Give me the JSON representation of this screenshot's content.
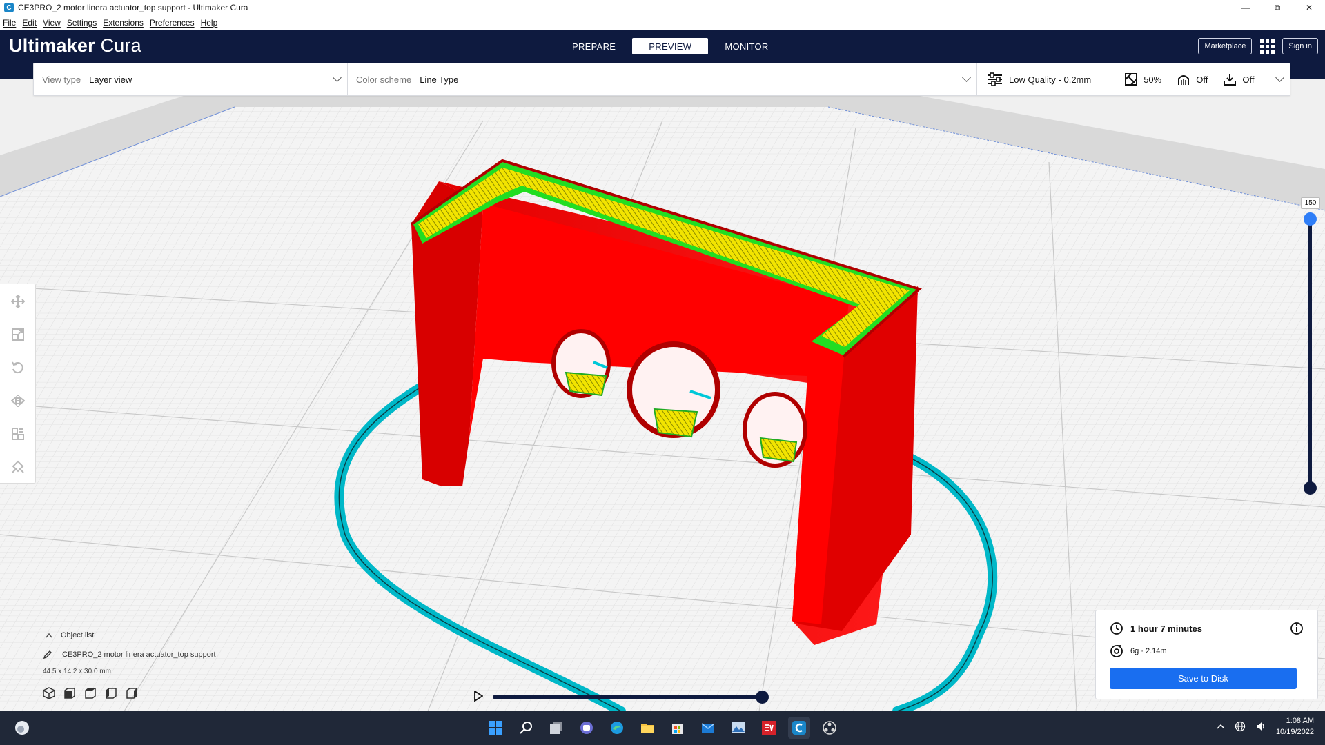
{
  "window": {
    "title": "CE3PRO_2 motor linera actuator_top support - Ultimaker Cura",
    "app_icon_letter": "C",
    "minimize": "—",
    "maximize": "⧉",
    "close": "✕"
  },
  "menu": {
    "items": [
      "File",
      "Edit",
      "View",
      "Settings",
      "Extensions",
      "Preferences",
      "Help"
    ]
  },
  "header": {
    "brand_bold": "Ultimaker",
    "brand_light": "Cura",
    "tabs": [
      "PREPARE",
      "PREVIEW",
      "MONITOR"
    ],
    "active_tab": "PREVIEW",
    "marketplace": "Marketplace",
    "sign_in": "Sign in"
  },
  "settings_bar": {
    "view_type_label": "View type",
    "view_type_value": "Layer view",
    "color_scheme_label": "Color scheme",
    "color_scheme_value": "Line Type",
    "profile": "Low Quality - 0.2mm",
    "infill": "50%",
    "support": "Off",
    "adhesion": "Off"
  },
  "tools": [
    "move-icon",
    "scale-icon",
    "rotate-icon",
    "mirror-icon",
    "per-model-settings-icon",
    "support-blocker-icon"
  ],
  "layer_slider": {
    "current_layer": "150"
  },
  "object_list": {
    "header": "Object list",
    "object_name": "CE3PRO_2 motor linera actuator_top support",
    "dimensions": "44.5 x 14.2 x 30.0 mm",
    "view_buttons": [
      "3d-view-icon",
      "front-view-icon",
      "top-view-icon",
      "left-view-icon",
      "right-view-icon"
    ]
  },
  "output": {
    "time": "1 hour 7 minutes",
    "material": "6g · 2.14m",
    "save_button": "Save to Disk"
  },
  "taskbar": {
    "time": "1:08 AM",
    "date": "10/19/2022"
  },
  "colors": {
    "header_bg": "#0e1a3f",
    "accent_blue": "#196ef0",
    "wall_red": "#ff0000",
    "skirt_cyan": "#00c8d8",
    "infill_yellow": "#f2e400",
    "skin_green": "#22dd22"
  }
}
